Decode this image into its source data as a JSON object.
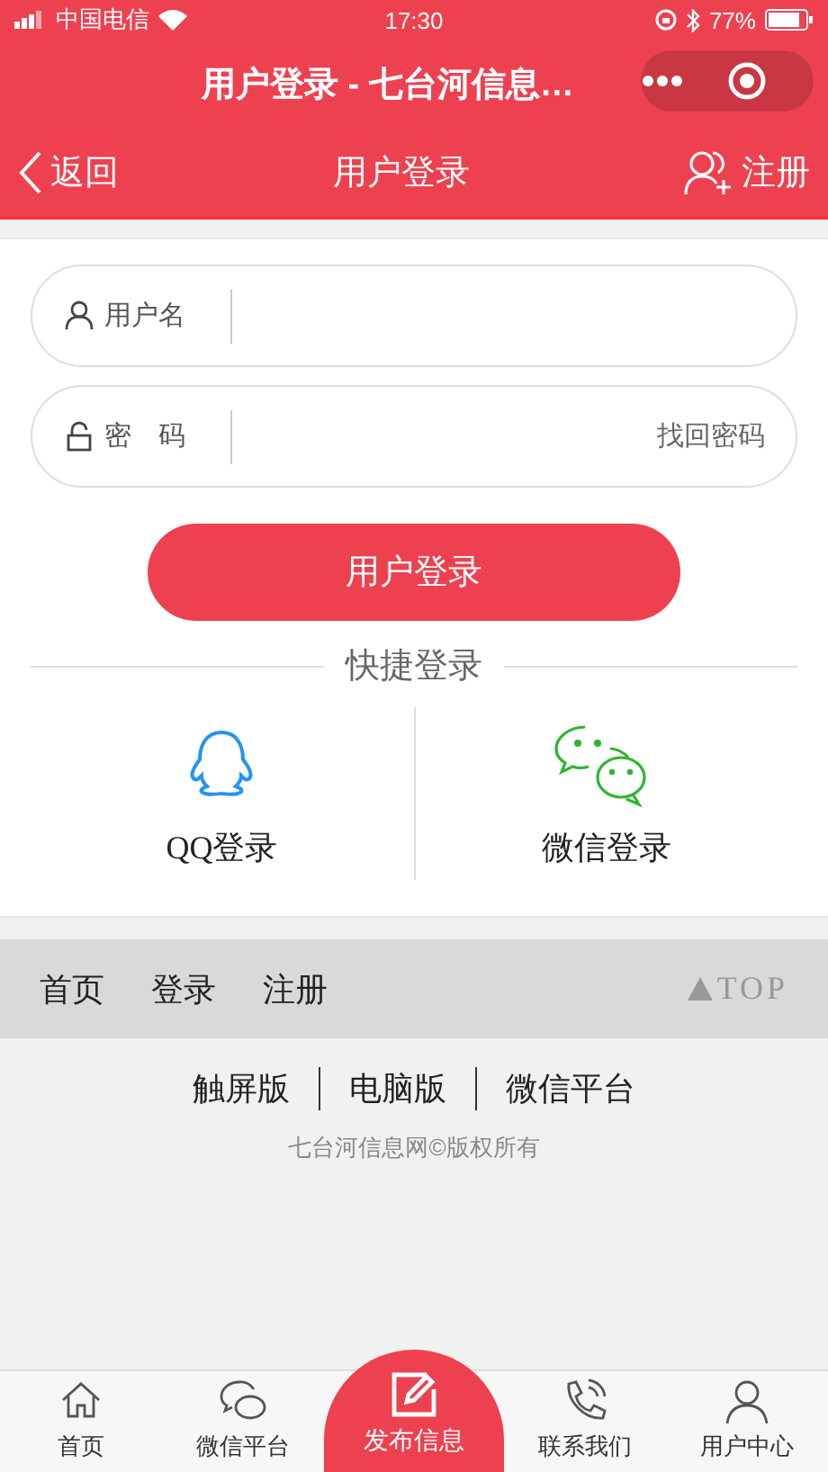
{
  "status_bar": {
    "carrier": "中国电信",
    "time": "17:30",
    "battery": "77%"
  },
  "title_bar": {
    "title": "用户登录 - 七台河信息…"
  },
  "nav_bar": {
    "back": "返回",
    "title": "用户登录",
    "register": "注册"
  },
  "form": {
    "fields": [
      {
        "kind": "user",
        "label": "用户名"
      },
      {
        "kind": "lock",
        "label": "密　码",
        "link": "找回密码"
      }
    ],
    "login_button": "用户登录"
  },
  "quick_login": {
    "title": "快捷登录",
    "options": [
      {
        "kind": "qq",
        "label": "QQ登录"
      },
      {
        "kind": "wechat",
        "label": "微信登录"
      }
    ]
  },
  "footer_nav": {
    "links": [
      "首页",
      "登录",
      "注册"
    ],
    "top": "TOP"
  },
  "versions": [
    "触屏版",
    "电脑版",
    "微信平台"
  ],
  "copyright": "七台河信息网©版权所有",
  "tab_bar": [
    {
      "kind": "home",
      "label": "首页"
    },
    {
      "kind": "wechat",
      "label": "微信平台"
    },
    {
      "kind": "publish",
      "label": "发布信息"
    },
    {
      "kind": "phone",
      "label": "联系我们"
    },
    {
      "kind": "user",
      "label": "用户中心"
    }
  ]
}
